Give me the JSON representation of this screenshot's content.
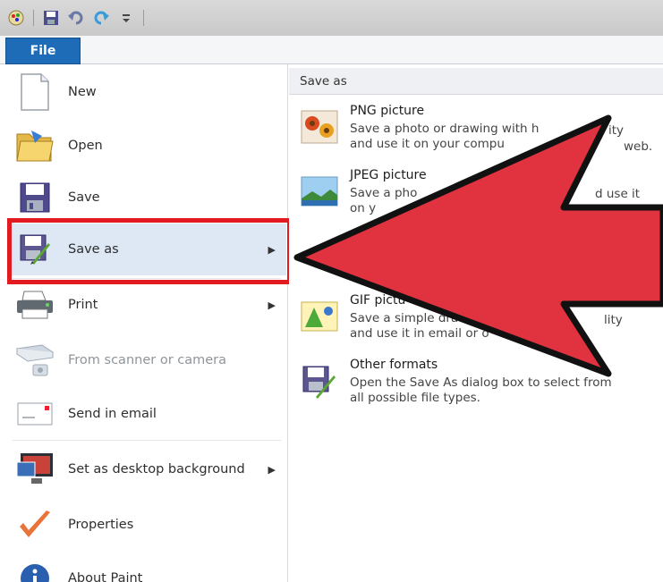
{
  "toolbar": {
    "icons": [
      "paint-app-icon",
      "save-icon",
      "undo-icon",
      "redo-icon",
      "customize-dropdown-icon"
    ]
  },
  "tabs": {
    "file_label": "File"
  },
  "menu": {
    "items": [
      {
        "label": "New",
        "icon": "new-document-icon"
      },
      {
        "label": "Open",
        "icon": "open-folder-icon"
      },
      {
        "label": "Save",
        "icon": "save-icon"
      },
      {
        "label": "Save as",
        "icon": "save-as-icon",
        "has_submenu": true,
        "highlighted": true
      },
      {
        "label": "Print",
        "icon": "printer-icon",
        "has_submenu": true
      },
      {
        "label": "From scanner or camera",
        "icon": "scanner-icon",
        "disabled": true
      },
      {
        "label": "Send in email",
        "icon": "email-icon"
      },
      {
        "label": "Set as desktop background",
        "icon": "desktop-background-icon",
        "has_submenu": true
      },
      {
        "label": "Properties",
        "icon": "checkmark-icon"
      },
      {
        "label": "About Paint",
        "icon": "info-icon"
      }
    ]
  },
  "submenu": {
    "header": "Save as",
    "items": [
      {
        "title": "PNG picture",
        "desc": "Save a photo or drawing with h",
        "desc2": "ity",
        "desc_line2": "and use it on your compu",
        "desc_line2b": "web.",
        "icon": "png-picture-icon"
      },
      {
        "title": "JPEG picture",
        "desc": "Save a pho",
        "desc2": "d use it",
        "desc_line2": "on y",
        "icon": "jpeg-picture-icon"
      },
      {
        "title": "GIF pictu",
        "desc": "Save a simple dra",
        "desc2": "lity",
        "desc_line2": "and use it in email or o",
        "icon": "gif-picture-icon"
      },
      {
        "title": "Other formats",
        "desc": "Open the Save As dialog box to select from",
        "desc_line2": "all possible file types.",
        "icon": "other-formats-icon"
      }
    ]
  },
  "colors": {
    "file_tab": "#1e6bb8",
    "highlight_box": "#e21b22",
    "arrow_fill": "#e0323f",
    "arrow_outline": "#111111"
  }
}
